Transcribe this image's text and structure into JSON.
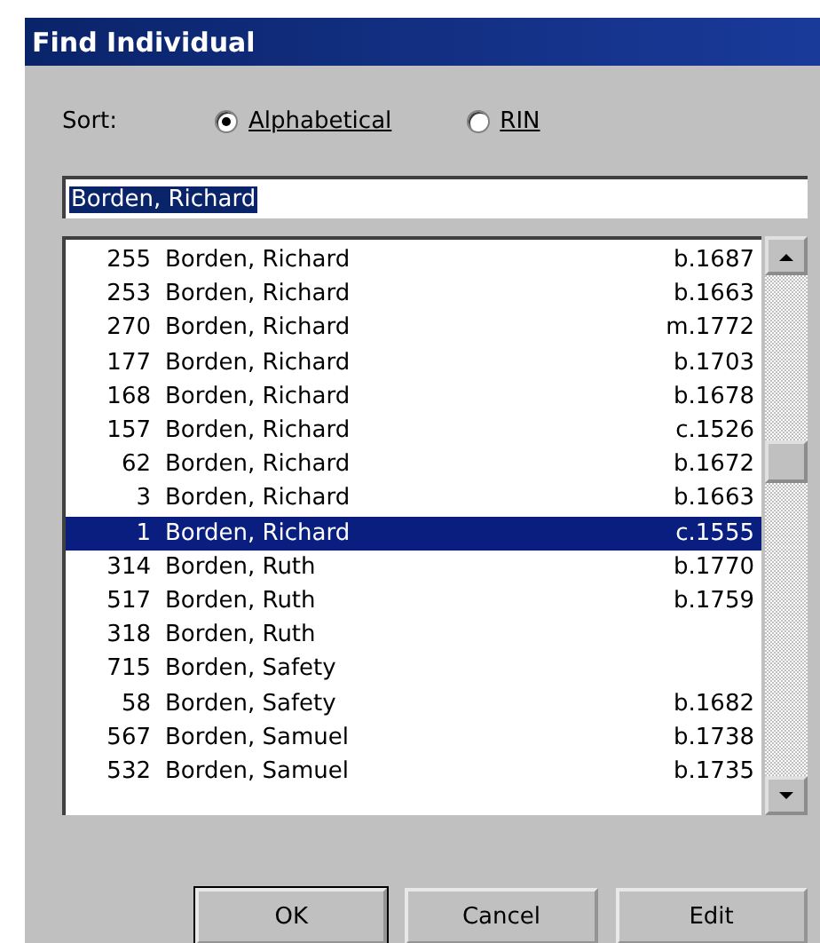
{
  "window": {
    "title": "Find Individual"
  },
  "sort": {
    "label": "Sort:",
    "options": [
      {
        "label": "Alphabetical",
        "selected": true
      },
      {
        "label": "RIN",
        "selected": false
      }
    ]
  },
  "search": {
    "value": "Borden, Richard",
    "highlighted": true
  },
  "list": {
    "rows": [
      {
        "rin": "255",
        "name": "Borden, Richard",
        "date": "b.1687",
        "selected": false
      },
      {
        "rin": "253",
        "name": "Borden, Richard",
        "date": "b.1663",
        "selected": false
      },
      {
        "rin": "270",
        "name": "Borden, Richard",
        "date": "m.1772",
        "selected": false
      },
      {
        "rin": "177",
        "name": "Borden, Richard",
        "date": "b.1703",
        "selected": false
      },
      {
        "rin": "168",
        "name": "Borden, Richard",
        "date": "b.1678",
        "selected": false
      },
      {
        "rin": "157",
        "name": "Borden, Richard",
        "date": "c.1526",
        "selected": false
      },
      {
        "rin": "62",
        "name": "Borden, Richard",
        "date": "b.1672",
        "selected": false
      },
      {
        "rin": "3",
        "name": "Borden, Richard",
        "date": "b.1663",
        "selected": false
      },
      {
        "rin": "1",
        "name": "Borden, Richard",
        "date": "c.1555",
        "selected": true
      },
      {
        "rin": "314",
        "name": "Borden, Ruth",
        "date": "b.1770",
        "selected": false
      },
      {
        "rin": "517",
        "name": "Borden, Ruth",
        "date": "b.1759",
        "selected": false
      },
      {
        "rin": "318",
        "name": "Borden, Ruth",
        "selected": false
      },
      {
        "rin": "715",
        "name": "Borden, Safety",
        "selected": false
      },
      {
        "rin": "58",
        "name": "Borden, Safety",
        "date": "b.1682",
        "selected": false
      },
      {
        "rin": "567",
        "name": "Borden, Samuel",
        "date": "b.1738",
        "selected": false
      },
      {
        "rin": "532",
        "name": "Borden, Samuel",
        "date": "b.1735",
        "selected": false
      }
    ]
  },
  "buttons": [
    {
      "label": "OK",
      "default": true
    },
    {
      "label": "Cancel",
      "default": false
    },
    {
      "label": "Edit",
      "default": false
    }
  ]
}
